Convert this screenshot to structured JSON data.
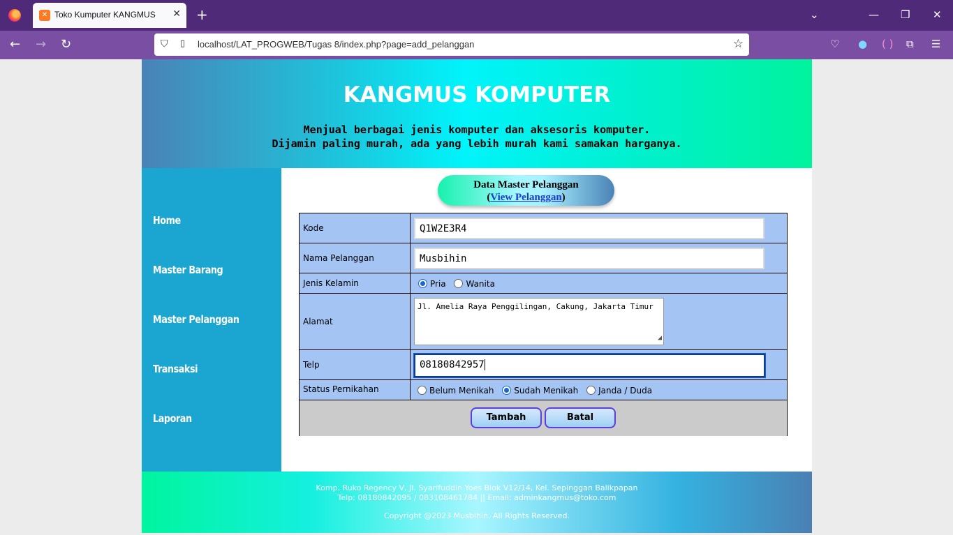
{
  "browser": {
    "tab_title": "Toko Kumputer KANGMUS",
    "tab_favicon": "xampp-icon",
    "url": "localhost/LAT_PROGWEB/Tugas 8/index.php?page=add_pelanggan"
  },
  "header": {
    "title": "KANGMUS KOMPUTER",
    "tagline_1": "Menjual berbagai jenis komputer dan aksesoris komputer.",
    "tagline_2": "Dijamin paling murah, ada yang lebih murah kami samakan harganya."
  },
  "sidebar": {
    "items": [
      {
        "label": "Home"
      },
      {
        "label": "Master Barang"
      },
      {
        "label": "Master Pelanggan"
      },
      {
        "label": "Transaksi"
      },
      {
        "label": "Laporan"
      }
    ]
  },
  "panel": {
    "title": "Data Master Pelanggan",
    "link_open": "(",
    "link_text": "View Pelanggan",
    "link_close": ")"
  },
  "form": {
    "kode_label": "Kode",
    "kode_value": "Q1W2E3R4",
    "nama_label": "Nama Pelanggan",
    "nama_value": "Musbihin",
    "jk_label": "Jenis Kelamin",
    "jk_options": [
      "Pria",
      "Wanita"
    ],
    "jk_selected": "Pria",
    "alamat_label": "Alamat",
    "alamat_value": "Jl. Amelia Raya Penggilingan, Cakung, Jakarta Timur",
    "telp_label": "Telp",
    "telp_value": "08180842957",
    "status_label": "Status Pernikahan",
    "status_options": [
      "Belum Menikah",
      "Sudah Menikah",
      "Janda / Duda"
    ],
    "status_selected": "Sudah Menikah",
    "submit_label": "Tambah",
    "cancel_label": "Batal"
  },
  "footer": {
    "address": "Komp. Ruko Regency V, Jl. Syarifuddin Yoes Blok V12/14, Kel. Sepinggan Balikpapan",
    "contact": "Telp: 08180842095 / 083108461784 || Email: adminkangmus@toko.com",
    "copyright": "Copyright @2023 Musbihin. All Rights Reserved."
  }
}
